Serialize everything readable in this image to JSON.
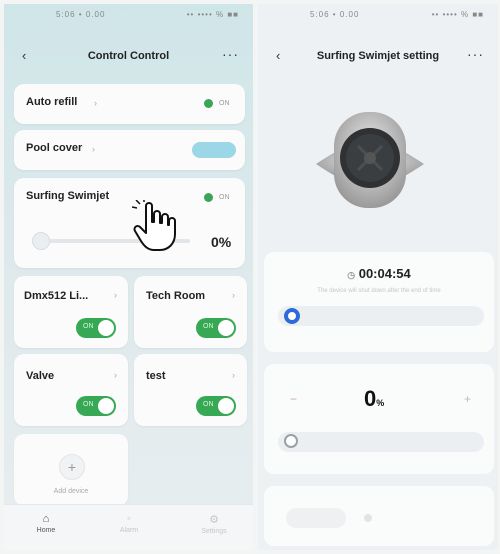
{
  "left": {
    "status_left": "5:06 • 0.00",
    "status_right": "•• •••• % ■■",
    "back_icon": "chevron-left-icon",
    "title": "Control Control",
    "more_label": "···",
    "cards": {
      "auto_refill": {
        "label": "Auto refill",
        "state": "ON"
      },
      "pool_cover": {
        "label": "Pool cover"
      },
      "surfing": {
        "label": "Surfing Swimjet",
        "state": "ON",
        "value": "0%",
        "level": 0
      },
      "dmx": {
        "label": "Dmx512 Li...",
        "toggle": "ON"
      },
      "tech": {
        "label": "Tech Room",
        "toggle": "ON"
      },
      "valve": {
        "label": "Valve",
        "toggle": "ON"
      },
      "test": {
        "label": "test",
        "toggle": "ON"
      },
      "add": {
        "plus": "+",
        "label": "Add device"
      }
    },
    "tabs": [
      {
        "label": "Home",
        "icon": "home-icon",
        "active": true
      },
      {
        "label": "Alarm",
        "icon": "alarm-icon",
        "active": false
      },
      {
        "label": "Settings",
        "icon": "settings-icon",
        "active": false
      }
    ],
    "accent": "#37a954",
    "pill_color": "#9bd7e6"
  },
  "right": {
    "status_left": "5:06 • 0.00",
    "status_right": "•• •••• % ■■",
    "back_icon": "chevron-left-icon",
    "title": "Surfing Swimjet setting",
    "more_label": "···",
    "timer": "00:04:54",
    "timer_icon": "clock-icon",
    "hint": "The device will shut down after the end of time",
    "speed_minus": "−",
    "speed_plus": "+",
    "speed_value": "0",
    "speed_unit": "%",
    "speed_level": 0,
    "accent": "#2e6bd8"
  }
}
